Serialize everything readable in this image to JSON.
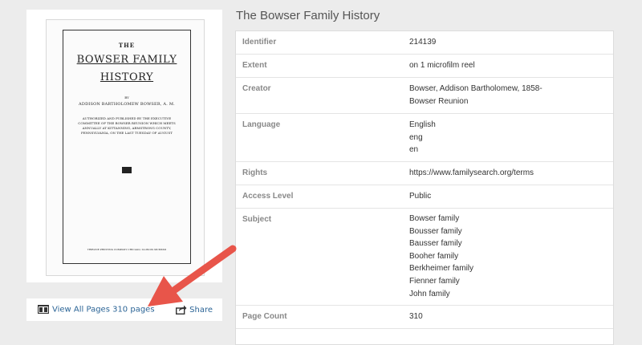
{
  "cover": {
    "the": "THE",
    "title_line1": "BOWSER FAMILY",
    "title_line2": "HISTORY",
    "by": "BY",
    "author": "ADDISON BARTHOLOMEW BOWSER, A. M.",
    "authorized": "AUTHORIZED AND PUBLISHED BY THE EXECUTIVE COMMITTEE OF THE BOWSER REUNION WHICH MEETS ANNUALLY AT KITTANNING, ARMSTRONG COUNTY, PENNSYLVANIA, ON THE LAST TUESDAY OF AUGUST",
    "publisher": "TRIBUNE PRINTING COMPANY CHICAGO, ILLINOIS MCMXXII"
  },
  "pages_bar": {
    "view_all_label": "View All Pages 310 pages",
    "share_label": "Share"
  },
  "title": "The Bowser Family History",
  "metadata": [
    {
      "label": "Identifier",
      "values": [
        "214139"
      ]
    },
    {
      "label": "Extent",
      "values": [
        "on 1 microfilm reel"
      ]
    },
    {
      "label": "Creator",
      "values": [
        "Bowser, Addison Bartholomew, 1858-",
        "Bowser Reunion"
      ]
    },
    {
      "label": "Language",
      "values": [
        "English",
        "eng",
        "en"
      ]
    },
    {
      "label": "Rights",
      "values": [
        "https://www.familysearch.org/terms"
      ]
    },
    {
      "label": "Access Level",
      "values": [
        "Public"
      ]
    },
    {
      "label": "Subject",
      "values": [
        "Bowser family",
        "Bousser family",
        "Bausser family",
        "Booher family",
        "Berkheimer family",
        "Fienner family",
        "John family"
      ]
    },
    {
      "label": "Page Count",
      "values": [
        "310"
      ]
    }
  ],
  "icons": {
    "view_pages": "film-icon",
    "share": "share-icon"
  },
  "colors": {
    "link": "#2b6496",
    "arrow": "#e8554a",
    "label": "#888888"
  }
}
